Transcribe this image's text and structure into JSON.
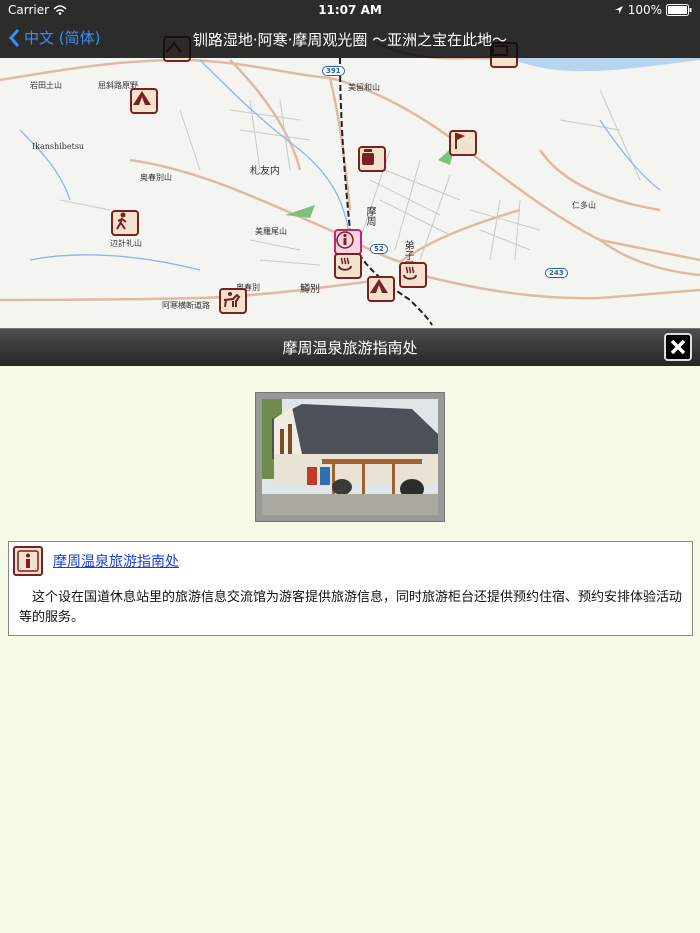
{
  "status_bar": {
    "carrier": "Carrier",
    "time": "11:07 AM",
    "battery": "100%"
  },
  "nav": {
    "back_label": "中文 (简体)",
    "title": "钏路湿地·阿寒·摩周观光圈 ～亚洲之宝在此地～"
  },
  "map": {
    "places": [
      "岩田土山",
      "屈斜路原野",
      "美留和山",
      "Ikanshibetsu",
      "札友内",
      "奥春別山",
      "美羅尾山",
      "摩周",
      "仁多山",
      "辺計礼山",
      "弟子屈",
      "鱒別",
      "阿寒横断道路",
      "奥春別"
    ],
    "route_numbers": [
      "391",
      "243",
      "52"
    ]
  },
  "detail": {
    "title": "摩周温泉旅游指南处",
    "link_text": "摩周温泉旅游指南处",
    "description": "这个设在国道休息站里的旅游信息交流馆为游客提供旅游信息，同时旅游柜台还提供预约住宿、预约安排体验活动等的服务。"
  },
  "colors": {
    "accent": "#3b8cf5",
    "poi_border": "#7a2020",
    "poi_fill": "#f3e2cd",
    "background": "#f5fbe6",
    "link": "#1a3fd8"
  }
}
